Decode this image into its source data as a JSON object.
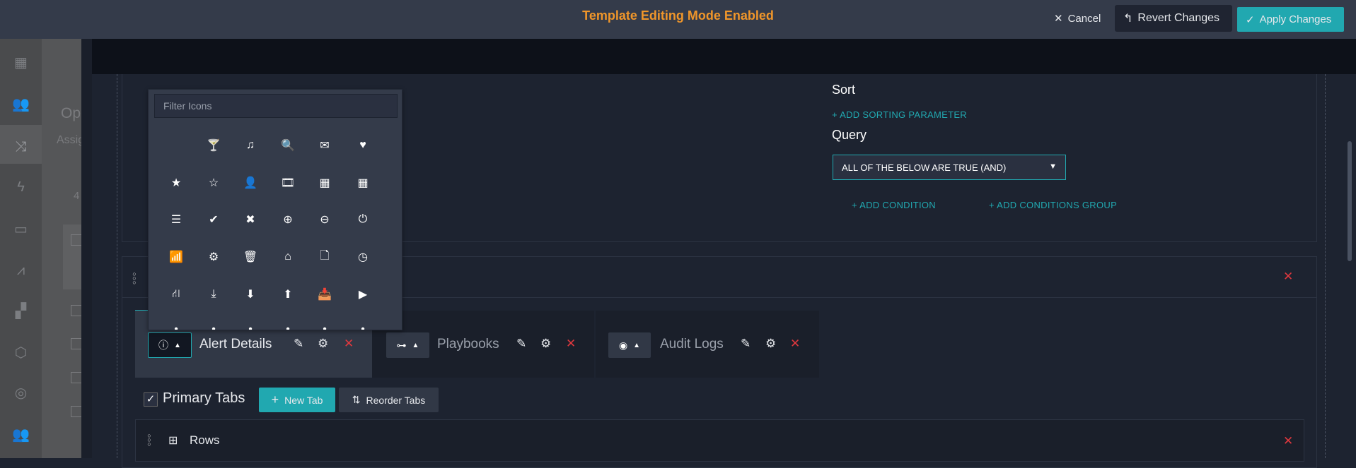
{
  "header": {
    "title": "Template Editing Mode Enabled",
    "cancel": "Cancel",
    "revert": "Revert Changes",
    "apply": "Apply Changes"
  },
  "sidebar": {
    "icons": [
      "dashboard-icon",
      "teams-icon",
      "shuffle-icon",
      "automation-icon",
      "briefcase-icon",
      "analytics-icon",
      "apps-icon",
      "hub-icon",
      "support-icon",
      "users-icon"
    ],
    "selected_index": 2
  },
  "background_panel": {
    "title_partial": "Op",
    "subtitle_partial": "Assig",
    "count_partial": "4"
  },
  "icon_picker": {
    "filter_placeholder": "Filter Icons",
    "icons": [
      {
        "name": "blank",
        "glyph": ""
      },
      {
        "name": "glass",
        "glyph": "🍸"
      },
      {
        "name": "music",
        "glyph": "♫"
      },
      {
        "name": "search",
        "glyph": "🔍"
      },
      {
        "name": "envelope",
        "glyph": "✉"
      },
      {
        "name": "heart",
        "glyph": "♥"
      },
      {
        "name": "star",
        "glyph": "★"
      },
      {
        "name": "star-empty",
        "glyph": "☆"
      },
      {
        "name": "user",
        "glyph": "👤"
      },
      {
        "name": "film",
        "glyph": "🎞"
      },
      {
        "name": "th-large",
        "glyph": "▦"
      },
      {
        "name": "th",
        "glyph": "▦"
      },
      {
        "name": "th-list",
        "glyph": "☰"
      },
      {
        "name": "ok",
        "glyph": "✔"
      },
      {
        "name": "remove",
        "glyph": "✖"
      },
      {
        "name": "zoom-in",
        "glyph": "⊕"
      },
      {
        "name": "zoom-out",
        "glyph": "⊖"
      },
      {
        "name": "off",
        "glyph": "⏻"
      },
      {
        "name": "signal",
        "glyph": "📶"
      },
      {
        "name": "cog",
        "glyph": "⚙"
      },
      {
        "name": "trash",
        "glyph": "🗑"
      },
      {
        "name": "home",
        "glyph": "⌂"
      },
      {
        "name": "file",
        "glyph": "🗋"
      },
      {
        "name": "time",
        "glyph": "◷"
      },
      {
        "name": "road",
        "glyph": "⛙"
      },
      {
        "name": "download-alt",
        "glyph": "⤓"
      },
      {
        "name": "download",
        "glyph": "⬇"
      },
      {
        "name": "upload",
        "glyph": "⬆"
      },
      {
        "name": "inbox",
        "glyph": "📥"
      },
      {
        "name": "play-circle",
        "glyph": "▶"
      }
    ]
  },
  "sort": {
    "label": "Sort",
    "add": "ADD SORTING PARAMETER"
  },
  "query": {
    "label": "Query",
    "selected": "ALL OF THE BELOW ARE TRUE (AND)",
    "add_condition": "ADD CONDITION",
    "add_group": "ADD CONDITIONS GROUP"
  },
  "tabs": [
    {
      "label": "Alert Details",
      "icon": "alert-icon",
      "glyph": "ⓘ",
      "active": true
    },
    {
      "label": "Playbooks",
      "icon": "playbook-icon",
      "glyph": "⊶",
      "active": false
    },
    {
      "label": "Audit Logs",
      "icon": "eye-icon",
      "glyph": "◉",
      "active": false
    }
  ],
  "primary_tabs": {
    "label": "Primary Tabs",
    "checked": true,
    "new_tab": "New Tab",
    "reorder": "Reorder Tabs"
  },
  "rows": {
    "label": "Rows"
  },
  "colors": {
    "accent": "#21a8b0",
    "warning": "#f0962a",
    "danger": "#e0383e"
  }
}
